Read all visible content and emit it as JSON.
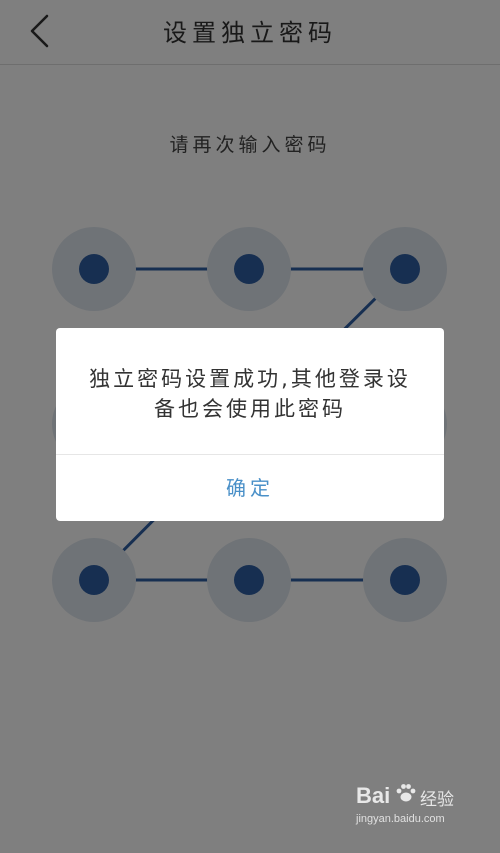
{
  "header": {
    "title": "设置独立密码",
    "back_icon": "chevron-left-icon"
  },
  "prompt": "请再次输入密码",
  "pattern": {
    "selected_sequence": [
      1,
      2,
      3,
      5,
      7,
      8,
      9
    ],
    "dot_color": "#2f5fa3",
    "ring_color": "#dfe6ee"
  },
  "dialog": {
    "message_line1": "独立密码设置成功,其他登录设",
    "message_line2": "备也会使用此密码",
    "confirm_label": "确定",
    "accent": "#4a90c8"
  },
  "watermark": {
    "brand": "Bai",
    "logo_icon": "paw-icon",
    "product": "经验",
    "url": "jingyan.baidu.com"
  }
}
